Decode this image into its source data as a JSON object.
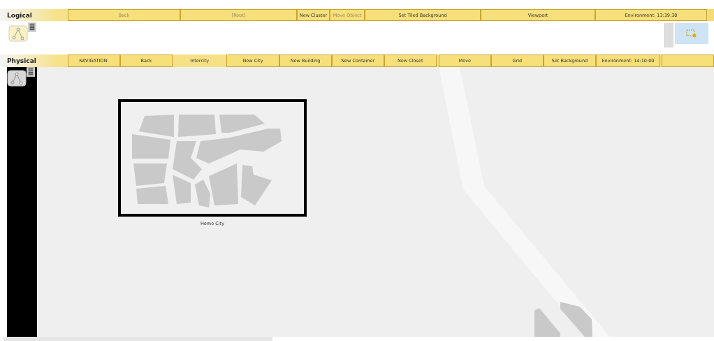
{
  "logical": {
    "title": "Logical",
    "buttons": [
      {
        "label": "Back",
        "disabled": true
      },
      {
        "label": "[Root]",
        "disabled": true
      },
      {
        "label": "New Cluster",
        "disabled": false
      },
      {
        "label": "Move Object",
        "disabled": true
      },
      {
        "label": "Set Tiled Background",
        "disabled": false
      },
      {
        "label": "Viewport",
        "disabled": false
      },
      {
        "label": "Environment: 13:39:30",
        "disabled": false
      }
    ]
  },
  "physical": {
    "title": "Physical",
    "buttons": [
      {
        "label": "NAVIGATION:",
        "kind": "button"
      },
      {
        "label": "Back",
        "kind": "button"
      },
      {
        "label": "Intercity",
        "kind": "label"
      },
      {
        "label": "New City",
        "kind": "button"
      },
      {
        "label": "New Building",
        "kind": "button"
      },
      {
        "label": "New Container",
        "kind": "button"
      },
      {
        "label": "New Closet",
        "kind": "button"
      },
      {
        "label": "Move",
        "kind": "button"
      },
      {
        "label": "Grid",
        "kind": "button"
      },
      {
        "label": "Set Background",
        "kind": "button"
      },
      {
        "label": "Environment: 14:10:00",
        "kind": "button"
      }
    ],
    "nodes": [
      {
        "label": "Home City",
        "kind": "city"
      },
      {
        "kind": "building"
      }
    ]
  }
}
